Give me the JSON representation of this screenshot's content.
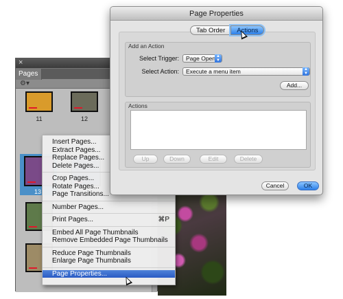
{
  "pages_panel": {
    "close_glyph": "×",
    "tab_label": "Pages",
    "options_glyph": "⚙▾",
    "thumbnails": [
      {
        "number": "11",
        "color": "#d99b2b"
      },
      {
        "number": "12",
        "color": "#6b6b5a"
      },
      {
        "number": "13",
        "color": "#7a4a88"
      },
      {
        "number": "",
        "color": "#3f6f9d"
      },
      {
        "number": "",
        "color": "#5e7a4a"
      },
      {
        "number": "",
        "color": "#9d8b66"
      }
    ]
  },
  "context_menu": {
    "items": [
      {
        "label": "Insert Pages..."
      },
      {
        "label": "Extract Pages..."
      },
      {
        "label": "Replace Pages..."
      },
      {
        "label": "Delete Pages..."
      },
      {
        "label": "Crop Pages..."
      },
      {
        "label": "Rotate Pages..."
      },
      {
        "label": "Page Transitions..."
      },
      {
        "label": "Number Pages..."
      },
      {
        "label": "Print Pages...",
        "shortcut": "⌘P"
      },
      {
        "label": "Embed All Page Thumbnails"
      },
      {
        "label": "Remove Embedded Page Thumbnails"
      },
      {
        "label": "Reduce Page Thumbnails"
      },
      {
        "label": "Enlarge Page Thumbnails"
      },
      {
        "label": "Page Properties..."
      }
    ]
  },
  "dialog": {
    "title": "Page Properties",
    "tabs": [
      "Tab Order",
      "Actions"
    ],
    "add_action": {
      "group_label": "Add an Action",
      "trigger_label": "Select Trigger:",
      "trigger_value": "Page Open",
      "action_label": "Select Action:",
      "action_value": "Execute a menu item",
      "add_button": "Add..."
    },
    "actions": {
      "group_label": "Actions",
      "buttons": [
        "Up",
        "Down",
        "Edit",
        "Delete"
      ]
    },
    "cancel_button": "Cancel",
    "ok_button": "OK"
  },
  "colors": {
    "accent": "#2c7fe8",
    "menu_highlight": "#2a5bc4",
    "thumb_bar": "#e0182a"
  }
}
